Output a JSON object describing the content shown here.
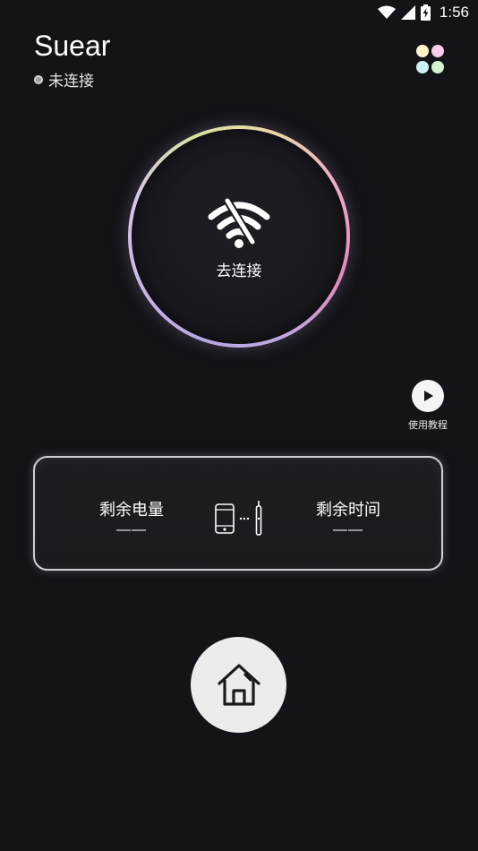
{
  "status_bar": {
    "time": "1:56",
    "icons": [
      "wifi-icon",
      "signal-icon",
      "battery-charging-icon"
    ]
  },
  "header": {
    "app_title": "Suear",
    "connection_status": "未连接",
    "menu_icon": "grid-dots-icon",
    "menu_dot_colors": [
      "#fff3c8",
      "#f7cdeb",
      "#cfeff6",
      "#d6f2cf"
    ]
  },
  "connect": {
    "icon": "wifi-off-icon",
    "label": "去连接"
  },
  "tutorial": {
    "icon": "play-icon",
    "label": "使用教程"
  },
  "info_card": {
    "battery_label": "剩余电量",
    "battery_value": "——",
    "time_label": "剩余时间",
    "time_value": "——",
    "device_icon": "phone-to-earpick-icon"
  },
  "bottom_nav": {
    "home_icon": "home-icon"
  }
}
